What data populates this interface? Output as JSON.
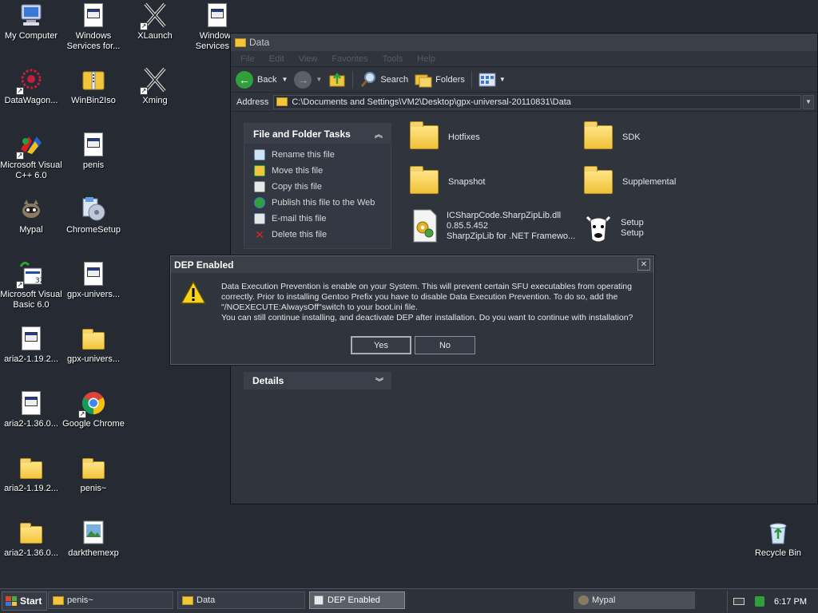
{
  "desktop": {
    "icons": [
      {
        "label": "My Computer"
      },
      {
        "label": "Windows Services for..."
      },
      {
        "label": "XLaunch"
      },
      {
        "label": "Windows Services fo"
      },
      {
        "label": "DataWagon..."
      },
      {
        "label": "WinBin2Iso"
      },
      {
        "label": "Xming"
      },
      {
        "label": "Microsoft Visual C++ 6.0"
      },
      {
        "label": "penis"
      },
      {
        "label": "Mypal"
      },
      {
        "label": "ChromeSetup"
      },
      {
        "label": "Microsoft Visual Basic 6.0"
      },
      {
        "label": "gpx-univers..."
      },
      {
        "label": "aria2-1.19.2..."
      },
      {
        "label": "gpx-univers..."
      },
      {
        "label": "aria2-1.36.0..."
      },
      {
        "label": "Google Chrome"
      },
      {
        "label": "aria2-1.19.2..."
      },
      {
        "label": "penis~"
      },
      {
        "label": "aria2-1.36.0..."
      },
      {
        "label": "darkthemexp"
      },
      {
        "label": "Recycle Bin"
      }
    ]
  },
  "explorer": {
    "title": "Data",
    "menu": [
      "File",
      "Edit",
      "View",
      "Favorites",
      "Tools",
      "Help"
    ],
    "toolbar": {
      "back": "Back",
      "search": "Search",
      "folders": "Folders"
    },
    "address_label": "Address",
    "address_value": "C:\\Documents and Settings\\VM2\\Desktop\\gpx-universal-20110831\\Data",
    "tasks_title": "File and Folder Tasks",
    "tasks": [
      "Rename this file",
      "Move this file",
      "Copy this file",
      "Publish this file to the Web",
      "E-mail this file",
      "Delete this file"
    ],
    "details_title": "Details",
    "items": {
      "hotfixes": "Hotfixes",
      "sdk": "SDK",
      "snapshot": "Snapshot",
      "supplemental": "Supplemental",
      "dll_name": "ICSharpCode.SharpZipLib.dll",
      "dll_version": "0.85.5.452",
      "dll_desc": "SharpZipLib for .NET Framewo...",
      "setup_line1": "Setup",
      "setup_line2": "Setup"
    }
  },
  "dialog": {
    "title": "DEP Enabled",
    "message_lines": [
      "Data Execution Prevention is enable on your System. This will prevent certain SFU executables from operating",
      "correctly. Prior to installing Gentoo Prefix you have to disable Data Execution Prevention. To do so, add the",
      "\"/NOEXECUTE:AlwaysOff\"switch to your boot.ini file.",
      "You can still continue installing, and deactivate DEP after installation. Do you want to continue with installation?"
    ],
    "yes": "Yes",
    "no": "No"
  },
  "taskbar": {
    "start": "Start",
    "tasks": [
      "penis~",
      "Data",
      "DEP Enabled",
      "Mypal"
    ],
    "clock": "6:17 PM"
  },
  "colors": {
    "desktop_bg": "#252a33",
    "window_bg": "#2f343d",
    "folder_yellow": "#f2c53d"
  }
}
